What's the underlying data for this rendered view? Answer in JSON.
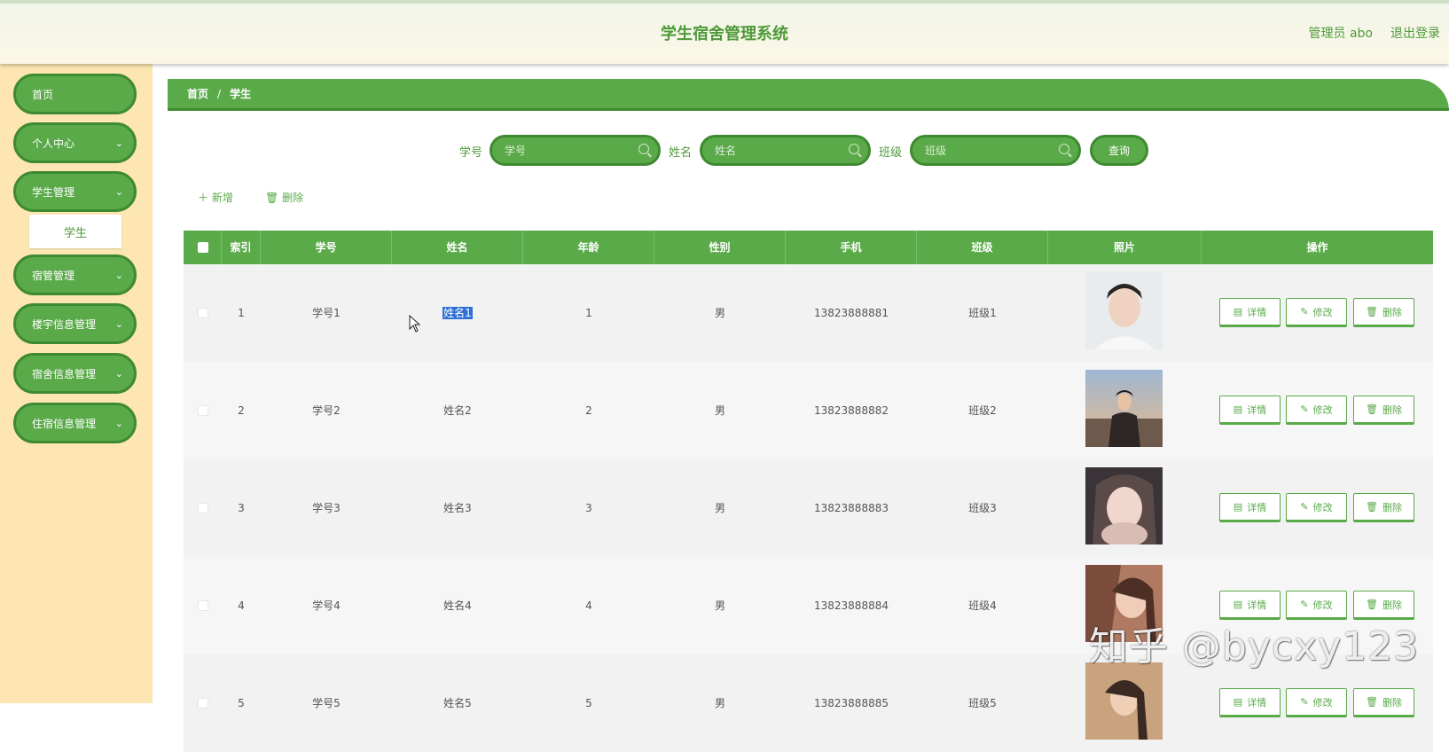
{
  "header": {
    "title": "学生宿舍管理系统",
    "admin": "管理员 abo",
    "logout": "退出登录"
  },
  "sidebar": {
    "items": [
      {
        "label": "首页"
      },
      {
        "label": "个人中心"
      },
      {
        "label": "学生管理"
      },
      {
        "label": "宿管管理"
      },
      {
        "label": "楼宇信息管理"
      },
      {
        "label": "宿舍信息管理"
      },
      {
        "label": "住宿信息管理"
      }
    ],
    "sub_item": "学生"
  },
  "breadcrumb": {
    "home": "首页",
    "sep": "/",
    "current": "学生"
  },
  "search": {
    "fields": [
      {
        "label": "学号",
        "placeholder": "学号"
      },
      {
        "label": "姓名",
        "placeholder": "姓名"
      },
      {
        "label": "班级",
        "placeholder": "班级"
      }
    ],
    "query_label": "查询"
  },
  "toolbar": {
    "add_label": "新增",
    "delete_label": "删除"
  },
  "table": {
    "columns": [
      "索引",
      "学号",
      "姓名",
      "年龄",
      "性别",
      "手机",
      "班级",
      "照片",
      "操作"
    ],
    "rows": [
      {
        "index": "1",
        "sid": "学号1",
        "name": "姓名1",
        "age": "1",
        "gender": "男",
        "phone": "13823888881",
        "cls": "班级1"
      },
      {
        "index": "2",
        "sid": "学号2",
        "name": "姓名2",
        "age": "2",
        "gender": "男",
        "phone": "13823888882",
        "cls": "班级2"
      },
      {
        "index": "3",
        "sid": "学号3",
        "name": "姓名3",
        "age": "3",
        "gender": "男",
        "phone": "13823888883",
        "cls": "班级3"
      },
      {
        "index": "4",
        "sid": "学号4",
        "name": "姓名4",
        "age": "4",
        "gender": "男",
        "phone": "13823888884",
        "cls": "班级4"
      },
      {
        "index": "5",
        "sid": "学号5",
        "name": "姓名5",
        "age": "5",
        "gender": "男",
        "phone": "13823888885",
        "cls": "班级5"
      }
    ],
    "actions": {
      "detail": "详情",
      "edit": "修改",
      "delete": "删除"
    }
  },
  "watermark": "知乎 @bycxy123",
  "colors": {
    "primary": "#5aaa4a",
    "primary_dark": "#3e8a30",
    "sidebar_bg": "#fde6b2",
    "header_bg": "#f8f8e8"
  }
}
